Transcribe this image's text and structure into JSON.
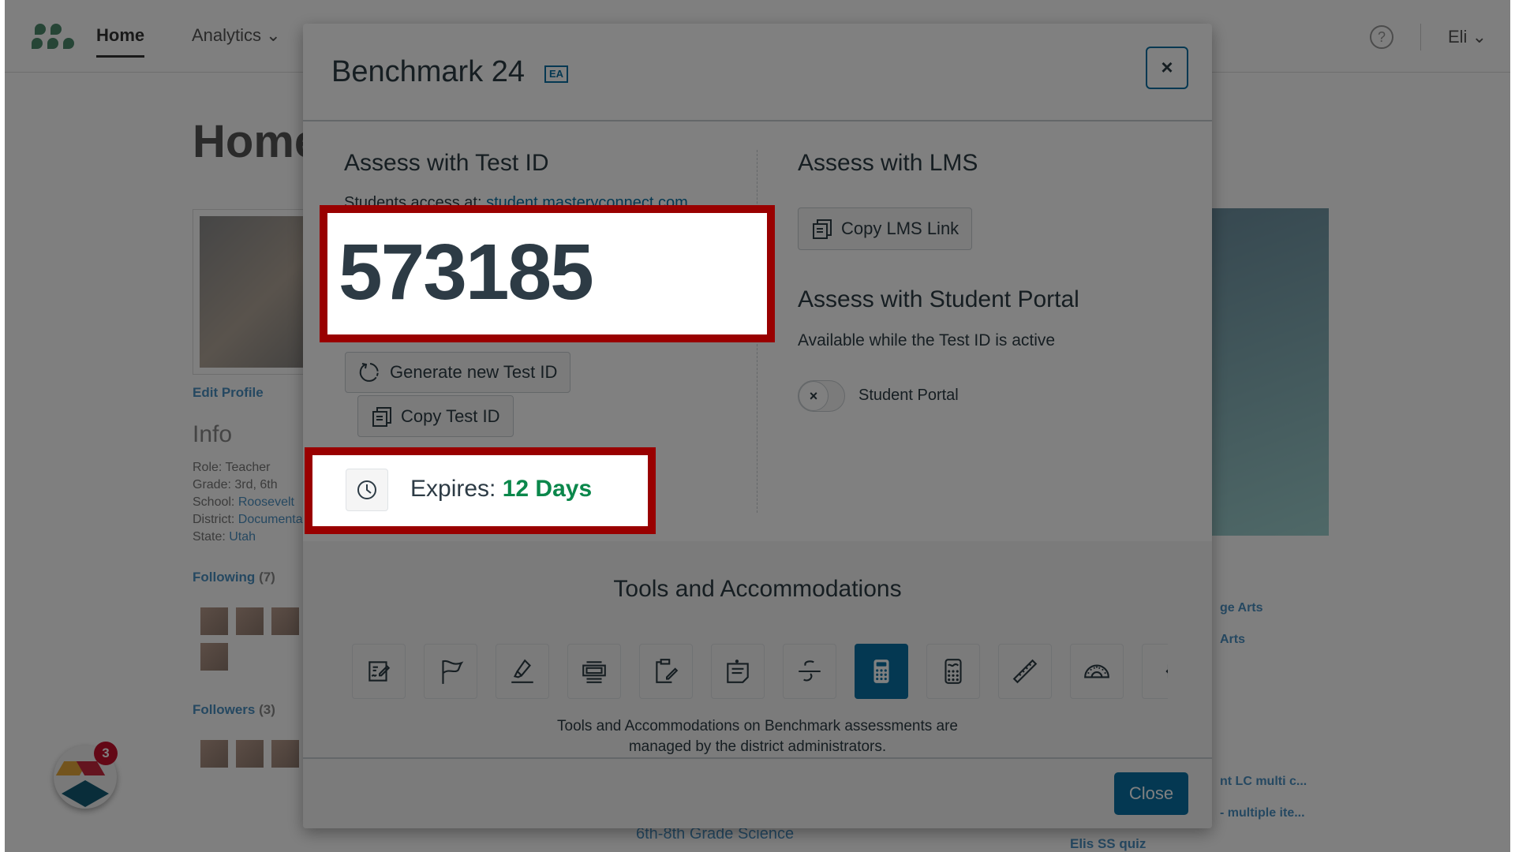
{
  "background": {
    "nav": {
      "home": "Home",
      "analytics": "Analytics",
      "user": "Eli",
      "help": "?"
    },
    "page_title": "Home",
    "edit_profile": "Edit Profile",
    "info_title": "Info",
    "info": [
      {
        "label": "Role: ",
        "value": "Teacher"
      },
      {
        "label": "Grade: ",
        "value": "3rd, 6th"
      },
      {
        "label": "School: ",
        "value": "Roosevelt"
      },
      {
        "label": "District: ",
        "value": "Documentation"
      },
      {
        "label": "State: ",
        "value": "Utah"
      }
    ],
    "following": "Following",
    "following_count": "(7)",
    "followers": "Followers",
    "followers_count": "(3)",
    "right_links": [
      "ge Arts",
      "Arts",
      "nt LC multi c...",
      " - multiple ite..."
    ],
    "bottom_items": [
      "6th-8th Grade Science",
      "Elis SS quiz"
    ],
    "chat_badge": "3"
  },
  "modal": {
    "title": "Benchmark 24",
    "badge": "EA",
    "close_x": "×",
    "test_id_section": {
      "heading": "Assess with Test ID",
      "access_prefix": "Students access at: ",
      "access_link": "student.masteryconnect.com",
      "test_id": "573185",
      "generate_label": "Generate new Test ID",
      "copy_label": "Copy Test ID",
      "expires_label": "Expires: ",
      "expires_value": "12 Days"
    },
    "lms_section": {
      "heading": "Assess with LMS",
      "copy_label": "Copy LMS Link"
    },
    "portal_section": {
      "heading": "Assess with Student Portal",
      "subtext": "Available while the Test ID is active",
      "toggle_label": "Student Portal",
      "toggle_state": "off",
      "toggle_glyph": "×"
    },
    "tools": {
      "heading": "Tools and Accommodations",
      "items": [
        {
          "name": "notepad-icon",
          "active": false
        },
        {
          "name": "flag-icon",
          "active": false
        },
        {
          "name": "highlighter-icon",
          "active": false
        },
        {
          "name": "line-reader-icon",
          "active": false
        },
        {
          "name": "clipboard-edit-icon",
          "active": false
        },
        {
          "name": "sticky-note-icon",
          "active": false
        },
        {
          "name": "strikethrough-icon",
          "active": false
        },
        {
          "name": "calculator-icon",
          "active": true
        },
        {
          "name": "graphing-calculator-icon",
          "active": false
        },
        {
          "name": "ruler-icon",
          "active": false
        },
        {
          "name": "protractor-icon",
          "active": false
        },
        {
          "name": "bracket-icon",
          "active": false
        }
      ],
      "note_line1": "Tools and Accommodations on Benchmark assessments are",
      "note_line2": "managed by the district administrators."
    },
    "close_label": "Close"
  },
  "colors": {
    "accent": "#0770a3",
    "highlight_border": "#990000",
    "expires_green": "#0b874b",
    "text": "#2d3b45"
  }
}
